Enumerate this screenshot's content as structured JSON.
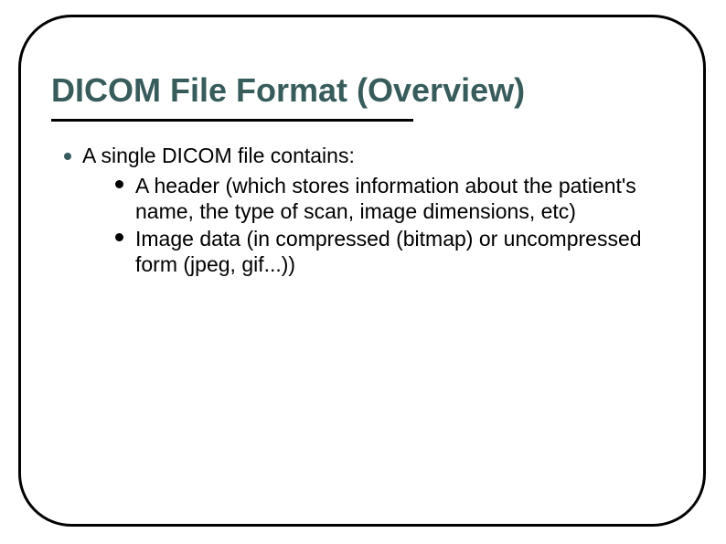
{
  "title": "DICOM File Format (Overview)",
  "main_item": "A single DICOM file contains:",
  "sub_items": [
    "A header (which stores information about the patient's name, the type of scan, image dimensions, etc)",
    "Image data (in compressed (bitmap) or uncompressed form (jpeg, gif...))"
  ],
  "colors": {
    "accent": "#385c5c"
  }
}
